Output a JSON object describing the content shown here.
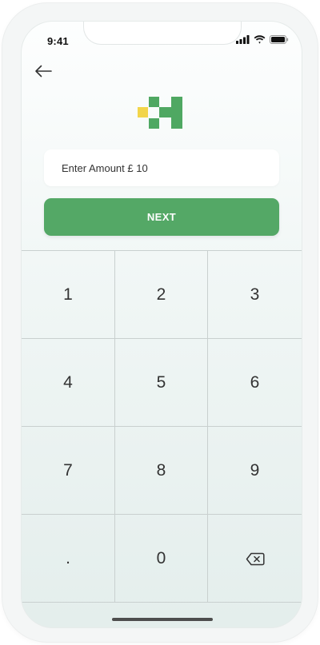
{
  "status_bar": {
    "time": "9:41",
    "icons": [
      "signal-icon",
      "wifi-icon",
      "battery-icon"
    ]
  },
  "header": {
    "back_icon": "arrow-left-icon"
  },
  "brand": {
    "logo_icon": "pixel-logo-icon",
    "colors": {
      "green": "#4fa862",
      "yellow": "#f2d54a"
    }
  },
  "amount": {
    "label": "Enter Amount £ 10"
  },
  "next_button": {
    "label": "NEXT",
    "color": "#54a866"
  },
  "keypad": {
    "keys": [
      "1",
      "2",
      "3",
      "4",
      "5",
      "6",
      "7",
      "8",
      "9",
      ".",
      "0"
    ],
    "backspace_icon": "backspace-icon"
  }
}
